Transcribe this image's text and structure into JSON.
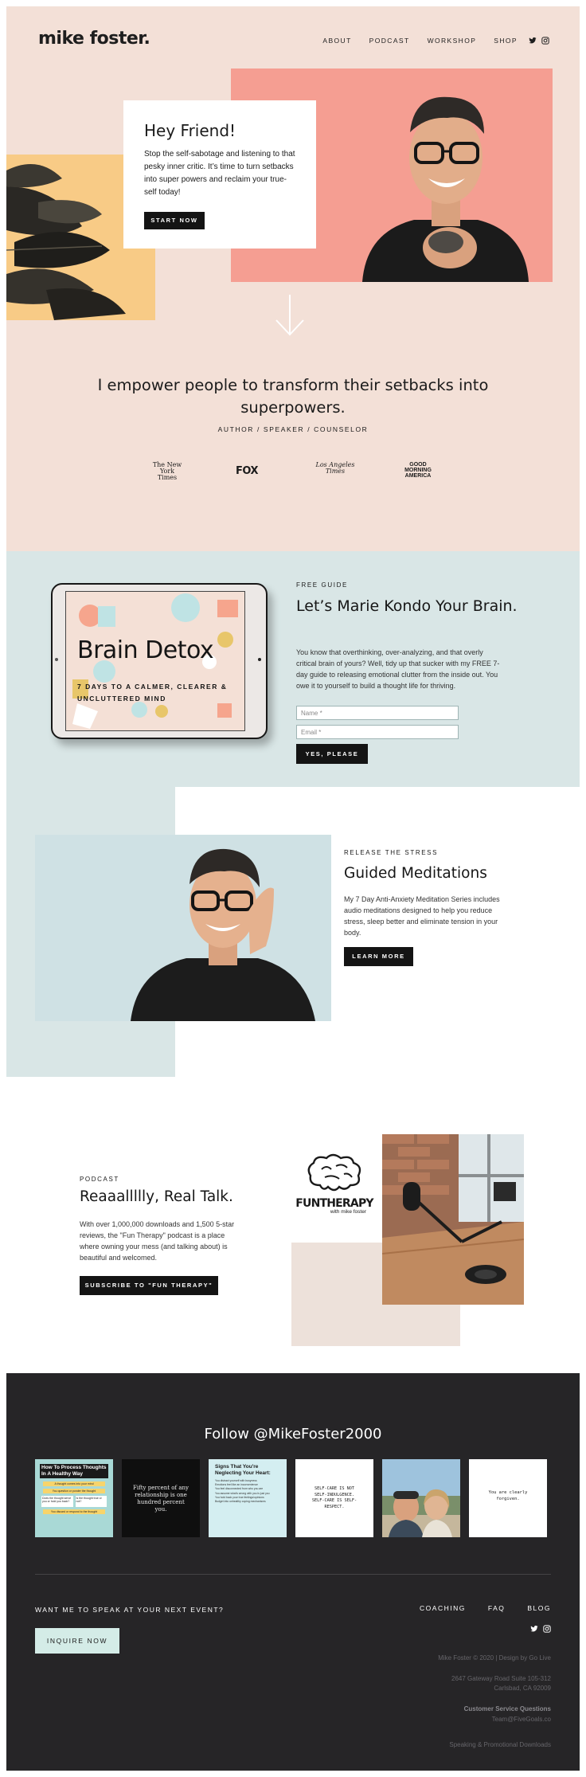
{
  "header": {
    "logo": "mike foster.",
    "nav": [
      "ABOUT",
      "PODCAST",
      "WORKSHOP",
      "SHOP"
    ],
    "social_icons": [
      "twitter-icon",
      "instagram-icon"
    ]
  },
  "hero": {
    "title": "Hey Friend!",
    "text": "Stop the self-sabotage and listening to that pesky inner critic. It’s time to turn setbacks into super powers and reclaim your true-self today!",
    "cta": "START NOW",
    "photo_bg": "#f59e92",
    "plant_bg": "#f8cb86"
  },
  "mission": {
    "headline": "I empower people to transform their setbacks into superpowers.",
    "roles": "AUTHOR / SPEAKER / COUNSELOR",
    "press": {
      "nyt": "The New York Times",
      "fox": "FOX",
      "lat": "Los Angeles Times",
      "gma": "GOOD MORNING AMERICA"
    }
  },
  "guide": {
    "tablet_title": "Brain Detox",
    "tablet_sub": "7 DAYS TO A CALMER, CLEARER & UNCLUTTERED MIND",
    "eyebrow": "FREE GUIDE",
    "title": "Let’s Marie Kondo Your Brain.",
    "text": "You know that overthinking, over-analyzing, and that overly critical brain of yours? Well, tidy up that sucker with my FREE 7-day guide to releasing emotional clutter from the inside out. You owe it to yourself to build a thought life for thriving.",
    "name_placeholder": "Name *",
    "email_placeholder": "Email *",
    "cta": "YES, PLEASE"
  },
  "meditations": {
    "eyebrow": "RELEASE THE STRESS",
    "title": "Guided Meditations",
    "text": "My 7 Day Anti-Anxiety Meditation Series includes audio meditations designed to help you reduce stress, sleep better and eliminate tension in your body.",
    "cta": "LEARN MORE"
  },
  "podcast": {
    "eyebrow": "PODCAST",
    "title": "Reaaallllly, Real Talk.",
    "text": "With over 1,000,000 downloads and 1,500 5-star reviews, the \"Fun Therapy\" podcast is a place where owning your mess (and talking about) is beautiful and welcomed.",
    "cta": "SUBSCRIBE TO \"FUN THERAPY\"",
    "logo_title": "FUNTHERAPY",
    "logo_sub": "with mike foster"
  },
  "instagram": {
    "title": "Follow @MikeFoster2000",
    "tile1": {
      "title": "How To Process Thoughts In A Healthy Way",
      "l1": "A thought comes into your mind",
      "l2": "You question or ponder the thought",
      "l3": "Does the thought serve you or hold you back?",
      "l4": "Is the thought true or not?",
      "l5": "You discard or respond to the thought"
    },
    "tile2": "Fifty percent of any relationship is one hundred percent you.",
    "tile3": {
      "title": "Signs That You're Neglecting Your Heart:",
      "items": [
        "You distract yourself with busyness",
        "Emotions feel like an inconvenience",
        "You feel disconnected from who you are",
        "You assume what's wrong with you is just you",
        "You hold back your true feelings/opinions",
        "Budget into unhealthy coping mechanisms"
      ]
    },
    "tile4": "SELF-CARE IS NOT SELF-INDULGENCE. SELF-CARE IS SELF-RESPECT.",
    "tile6": "You are clearly forgiven."
  },
  "footer": {
    "question": "WANT ME TO SPEAK AT YOUR NEXT EVENT?",
    "cta": "INQUIRE NOW",
    "links": [
      "COACHING",
      "FAQ",
      "BLOG"
    ],
    "copyright": "Mike Foster © 2020 | Design by Go Live",
    "address1": "2647 Gateway Road Suite 105-312",
    "address2": "Carlsbad, CA 92009",
    "cs_title": "Customer Service Questions",
    "cs_email": "Team@FiveGoals.co",
    "downloads": "Speaking & Promotional Downloads"
  }
}
